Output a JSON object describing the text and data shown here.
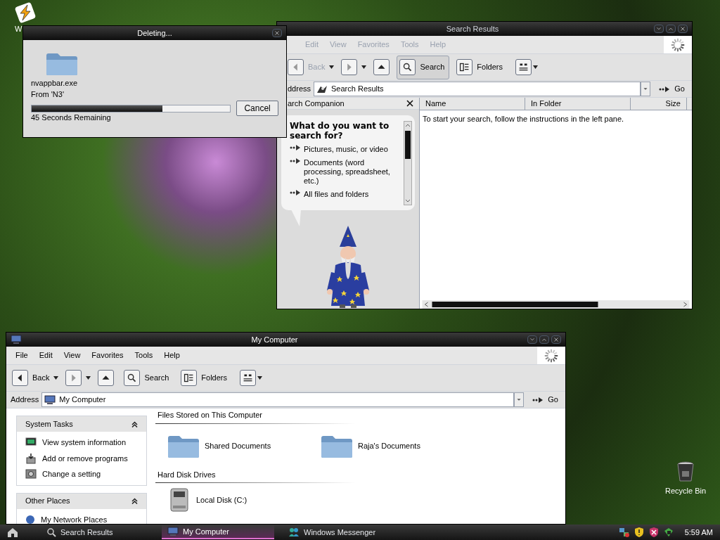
{
  "desktop_icons": [
    {
      "label": "W"
    },
    {
      "label": "Recycle Bin"
    }
  ],
  "delete_dialog": {
    "title": "Deleting...",
    "file_name": "nvappbar.exe",
    "source": "From 'N3'",
    "progress": {
      "level": 0.66
    },
    "time_remaining": "45 Seconds Remaining",
    "cancel_button": "Cancel"
  },
  "search_window": {
    "title": "Search Results",
    "active": false,
    "menu": [
      "Edit",
      "View",
      "Favorites",
      "Tools",
      "Help"
    ],
    "toolbar": {
      "back": {
        "label": "Back",
        "disabled": true
      },
      "search": {
        "label": "Search",
        "pressed": true
      },
      "folders": {
        "label": "Folders"
      }
    },
    "address": {
      "label": "ddress",
      "value": "Search Results",
      "go": "Go"
    },
    "companion": {
      "title": "arch Companion",
      "question": "What do you want to search for?",
      "options": [
        "Pictures, music, or video",
        "Documents (word processing, spreadsheet, etc.)",
        "All files and folders"
      ]
    },
    "results": {
      "columns": [
        "Name",
        "In Folder",
        "Size"
      ],
      "message": "To start your search, follow the instructions in the left pane."
    }
  },
  "computer_window": {
    "title": "My Computer",
    "active": true,
    "menu": [
      "File",
      "Edit",
      "View",
      "Favorites",
      "Tools",
      "Help"
    ],
    "toolbar": {
      "back": {
        "label": "Back",
        "disabled": false
      },
      "search": {
        "label": "Search",
        "pressed": false
      },
      "folders": {
        "label": "Folders"
      }
    },
    "address": {
      "label": "Address",
      "value": "My Computer",
      "go": "Go"
    },
    "task_panels": [
      {
        "title": "System Tasks",
        "expanded": true,
        "items": [
          "View system information",
          "Add or remove programs",
          "Change a setting"
        ]
      },
      {
        "title": "Other Places",
        "expanded": true,
        "items": [
          "My Network Places"
        ]
      }
    ],
    "sections": [
      {
        "title": "Files Stored on This Computer",
        "items": [
          {
            "kind": "folder",
            "label": "Shared Documents"
          },
          {
            "kind": "folder",
            "label": "Raja's Documents"
          }
        ]
      },
      {
        "title": "Hard Disk Drives",
        "items": [
          {
            "kind": "drive",
            "label": "Local Disk (C:)"
          }
        ]
      }
    ]
  },
  "taskbar": {
    "tasks": [
      {
        "label": "Search Results",
        "selected": false
      },
      {
        "label": "My Computer",
        "selected": true
      },
      {
        "label": "Windows Messenger",
        "selected": false
      }
    ],
    "clock": "5:59 AM"
  }
}
